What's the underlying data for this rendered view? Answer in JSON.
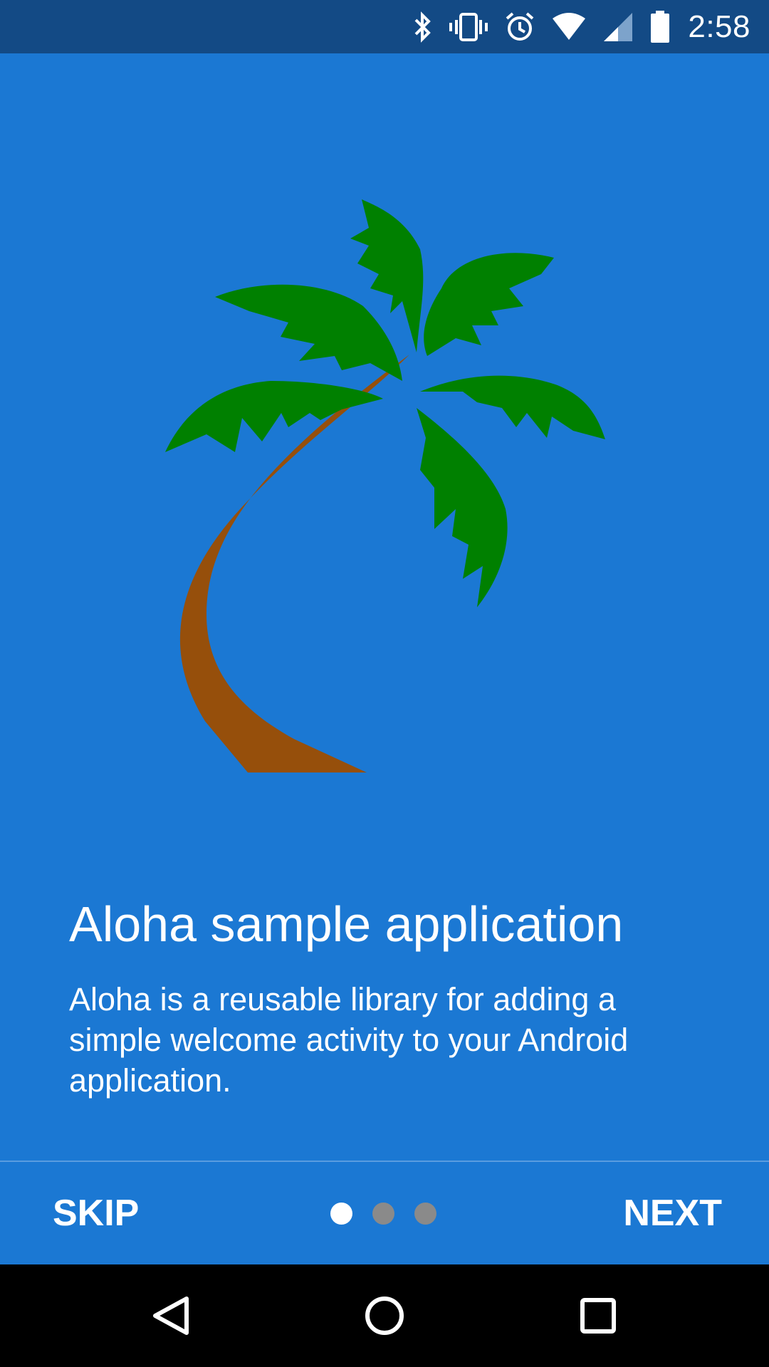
{
  "status_bar": {
    "time": "2:58",
    "icons": [
      "bluetooth-icon",
      "vibrate-icon",
      "alarm-icon",
      "wifi-icon",
      "cell-signal-icon",
      "battery-icon"
    ]
  },
  "welcome": {
    "illustration": "palm-tree",
    "title": "Aloha sample application",
    "description": "Aloha is a reusable library for adding a simple welcome activity to your Android application."
  },
  "footer": {
    "skip_label": "SKIP",
    "next_label": "NEXT",
    "page_count": 3,
    "current_page": 1
  },
  "nav_bar": {
    "buttons": [
      "back-icon",
      "home-icon",
      "recents-icon"
    ]
  },
  "colors": {
    "background": "#1b78d3",
    "status_bar": "#134a85",
    "palm_leaves": "#008000",
    "palm_trunk": "#964f0b",
    "dot_active": "#ffffff",
    "dot_inactive": "#8a8a8a",
    "nav_bar": "#000000"
  }
}
